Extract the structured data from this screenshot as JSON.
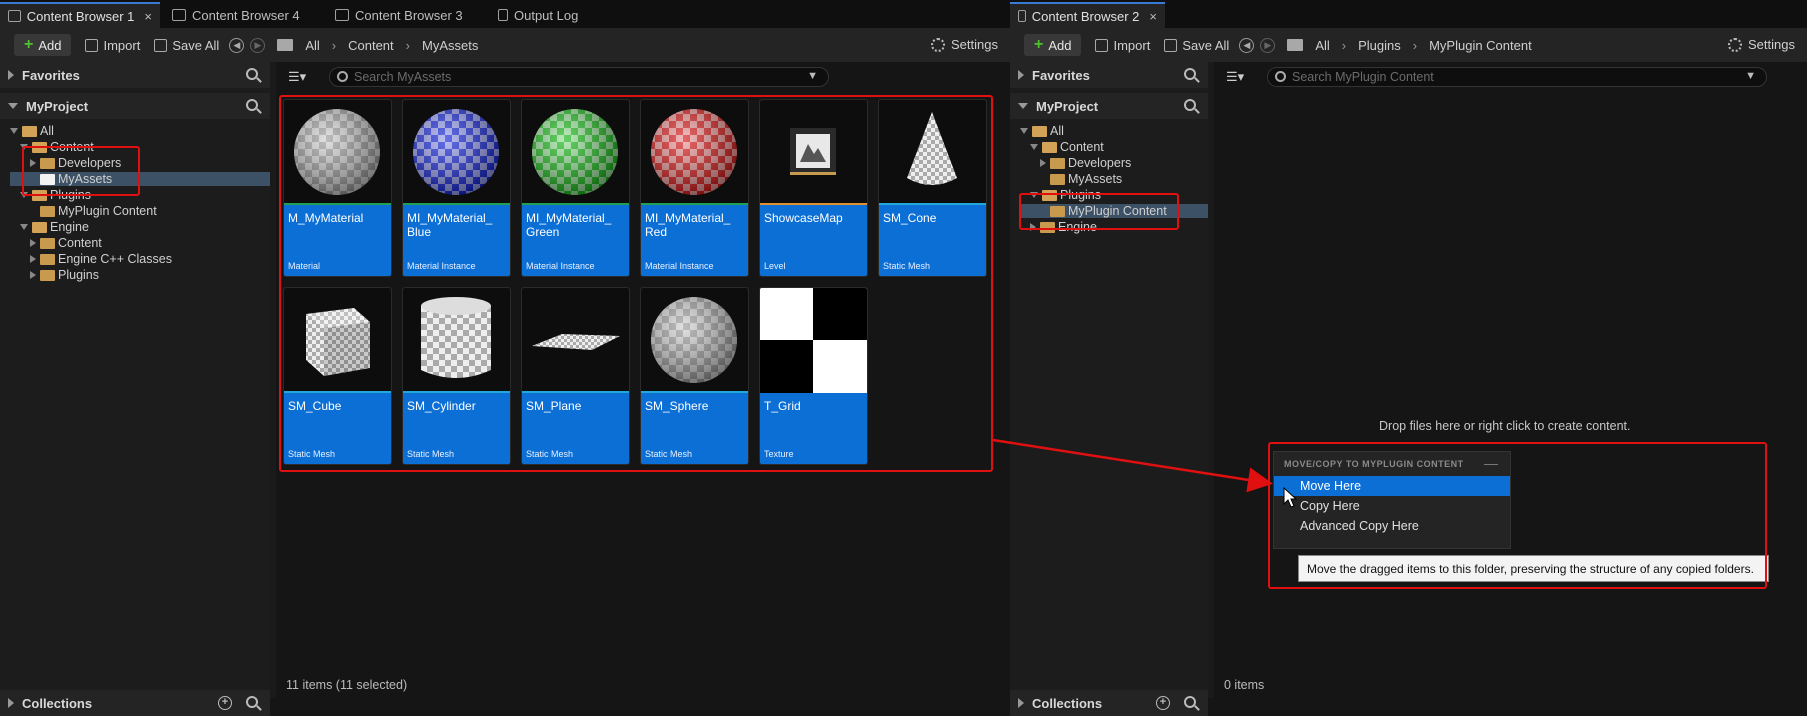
{
  "left_tabs": [
    {
      "label": "Content Browser 1",
      "active": true
    },
    {
      "label": "Content Browser 4"
    },
    {
      "label": "Content Browser 3"
    },
    {
      "label": "Output Log"
    }
  ],
  "right_tabs": [
    {
      "label": "Content Browser 2",
      "active": true
    }
  ],
  "close_glyph": "×",
  "left": {
    "toolbar": {
      "add": "Add",
      "import": "Import",
      "save_all": "Save All",
      "breadcrumb": [
        "All",
        "Content",
        "MyAssets"
      ],
      "settings": "Settings"
    },
    "favorites": "Favorites",
    "project": "MyProject",
    "collections": "Collections",
    "tree": [
      {
        "label": "All",
        "depth": 0,
        "state": "open"
      },
      {
        "label": "Content",
        "depth": 1,
        "state": "open"
      },
      {
        "label": "Developers",
        "depth": 2,
        "state": "closed"
      },
      {
        "label": "MyAssets",
        "depth": 2,
        "state": "leaf",
        "selected": true
      },
      {
        "label": "Plugins",
        "depth": 1,
        "state": "open"
      },
      {
        "label": "MyPlugin Content",
        "depth": 2,
        "state": "leaf"
      },
      {
        "label": "Engine",
        "depth": 1,
        "state": "open"
      },
      {
        "label": "Content",
        "depth": 2,
        "state": "closed"
      },
      {
        "label": "Engine C++ Classes",
        "depth": 2,
        "state": "closed"
      },
      {
        "label": "Plugins",
        "depth": 2,
        "state": "closed"
      }
    ],
    "search_placeholder": "Search MyAssets",
    "status": "11 items (11 selected)",
    "assets": [
      {
        "name": "M_MyMaterial",
        "type": "Material",
        "thumb": "sphere-white"
      },
      {
        "name": "MI_MyMaterial_ Blue",
        "type": "Material Instance",
        "thumb": "sphere-blue"
      },
      {
        "name": "MI_MyMaterial_ Green",
        "type": "Material Instance",
        "thumb": "sphere-green"
      },
      {
        "name": "MI_MyMaterial_ Red",
        "type": "Material Instance",
        "thumb": "sphere-red"
      },
      {
        "name": "ShowcaseMap",
        "type": "Level",
        "thumb": "level"
      },
      {
        "name": "SM_Cone",
        "type": "Static Mesh",
        "thumb": "cone"
      },
      {
        "name": "SM_Cube",
        "type": "Static Mesh",
        "thumb": "cube"
      },
      {
        "name": "SM_Cylinder",
        "type": "Static Mesh",
        "thumb": "cylinder"
      },
      {
        "name": "SM_Plane",
        "type": "Static Mesh",
        "thumb": "plane"
      },
      {
        "name": "SM_Sphere",
        "type": "Static Mesh",
        "thumb": "sphere-white"
      },
      {
        "name": "T_Grid",
        "type": "Texture",
        "thumb": "grid"
      }
    ]
  },
  "right": {
    "toolbar": {
      "add": "Add",
      "import": "Import",
      "save_all": "Save All",
      "breadcrumb": [
        "All",
        "Plugins",
        "MyPlugin Content"
      ],
      "settings": "Settings"
    },
    "favorites": "Favorites",
    "project": "MyProject",
    "collections": "Collections",
    "tree": [
      {
        "label": "All",
        "depth": 0,
        "state": "open"
      },
      {
        "label": "Content",
        "depth": 1,
        "state": "open"
      },
      {
        "label": "Developers",
        "depth": 2,
        "state": "closed"
      },
      {
        "label": "MyAssets",
        "depth": 2,
        "state": "leaf"
      },
      {
        "label": "Plugins",
        "depth": 1,
        "state": "open"
      },
      {
        "label": "MyPlugin Content",
        "depth": 2,
        "state": "leaf",
        "selected": true
      },
      {
        "label": "Engine",
        "depth": 1,
        "state": "closed"
      }
    ],
    "search_placeholder": "Search MyPlugin Content",
    "drop_hint": "Drop files here or right click to create content.",
    "status": "0 items"
  },
  "context_menu": {
    "title": "MOVE/COPY TO MYPLUGIN CONTENT",
    "items": [
      "Move Here",
      "Copy Here",
      "Advanced Copy Here"
    ],
    "highlighted": 0
  },
  "tooltip": "Move the dragged items to this folder, preserving the structure of any copied folders.",
  "colors": {
    "accent": "#0c6fd6",
    "annotation": "#e01010",
    "folder": "#c79a4d"
  }
}
